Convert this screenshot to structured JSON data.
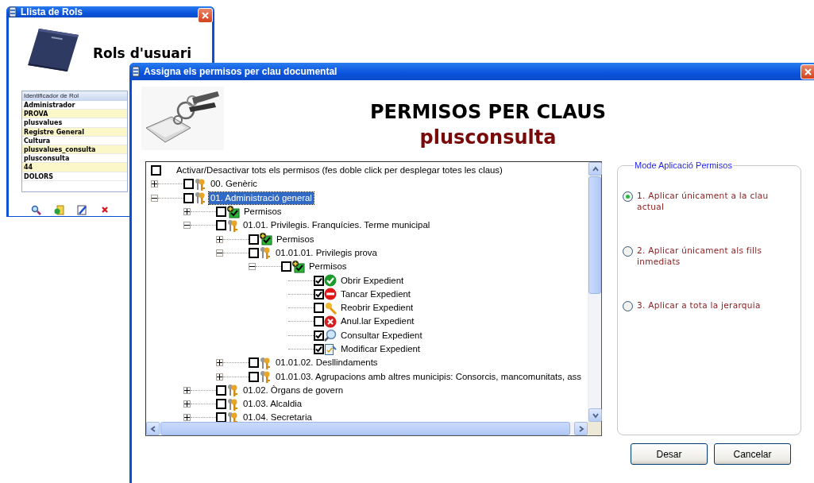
{
  "roles_window": {
    "title": "Llista de Rols",
    "heading": "Rols d'usuari",
    "table": {
      "columns": [
        "Identificador de Rol"
      ],
      "rows": [
        "Administrador",
        "PROVA",
        "plusvalues",
        "Registre General",
        "Cultura",
        "plusvalues_consulta",
        "plusconsulta",
        "44",
        "DOLORS"
      ]
    },
    "tools": [
      {
        "kind": "search"
      },
      {
        "kind": "add"
      },
      {
        "kind": "edit"
      },
      {
        "kind": "delete"
      }
    ]
  },
  "permissions_window": {
    "title": "Assigna els permisos per clau documental",
    "heading": "PERMISOS PER CLAUS",
    "role": "plusconsulta",
    "tree": {
      "toggle_all": {
        "label": "Activar/Desactivar tots els permisos (fes doble click per desplegar totes les claus)",
        "checked": false
      },
      "items": [
        {
          "label": "00. Genèric",
          "kind": "key",
          "checked": false,
          "expanded": false,
          "selected": false
        },
        {
          "label": "01. Administració general",
          "kind": "key",
          "checked": false,
          "expanded": true,
          "selected": true,
          "children": [
            {
              "label": "Permisos",
              "kind": "permissions",
              "checked": false,
              "expanded": false,
              "selected": false
            },
            {
              "label": "01.01. Privilegis. Franquícies. Terme municipal",
              "kind": "key",
              "checked": false,
              "expanded": true,
              "selected": false,
              "children": [
                {
                  "label": "Permisos",
                  "kind": "permissions",
                  "checked": false,
                  "expanded": false,
                  "selected": false
                },
                {
                  "label": "01.01.01. Privilegis prova",
                  "kind": "key",
                  "checked": false,
                  "expanded": true,
                  "selected": false,
                  "children": [
                    {
                      "label": "Permisos",
                      "kind": "permissions",
                      "checked": false,
                      "expanded": true,
                      "selected": false,
                      "children": [
                        {
                          "label": "Obrir Expedient",
                          "kind": "open",
                          "checked": true,
                          "selected": false
                        },
                        {
                          "label": "Tancar Expedient",
                          "kind": "close",
                          "checked": true,
                          "selected": false
                        },
                        {
                          "label": "Reobrir Expedient",
                          "kind": "reopen",
                          "checked": false,
                          "selected": false
                        },
                        {
                          "label": "Anul.lar Expedient",
                          "kind": "cancel",
                          "checked": false,
                          "selected": false
                        },
                        {
                          "label": "Consultar Expedient",
                          "kind": "consult",
                          "checked": true,
                          "selected": false
                        },
                        {
                          "label": "Modificar Expedient",
                          "kind": "modify",
                          "checked": true,
                          "selected": false
                        }
                      ]
                    }
                  ]
                },
                {
                  "label": "01.01.02. Desllindaments",
                  "kind": "key",
                  "checked": false,
                  "expanded": false,
                  "selected": false
                },
                {
                  "label": "01.01.03. Agrupacions amb altres municipis: Consorcis, mancomunitats, ass",
                  "kind": "key",
                  "checked": false,
                  "expanded": false,
                  "selected": false
                }
              ]
            },
            {
              "label": "01.02. Òrgans de govern",
              "kind": "key",
              "checked": false,
              "expanded": false,
              "selected": false
            },
            {
              "label": "01.03. Alcaldia",
              "kind": "key",
              "checked": false,
              "expanded": false,
              "selected": false
            },
            {
              "label": "01.04. Secretaria",
              "kind": "key",
              "checked": false,
              "expanded": false,
              "selected": false
            }
          ]
        }
      ]
    },
    "mode": {
      "legend": "Mode Aplicació Permisos",
      "options": [
        {
          "label": "1. Aplicar únicament a la clau actual",
          "selected": true
        },
        {
          "label": "2. Aplicar únicament als fills inmediats",
          "selected": false
        },
        {
          "label": "3. Aplicar a tota la jerarquia",
          "selected": false
        }
      ]
    },
    "buttons": [
      "Desar",
      "Cancelar"
    ]
  }
}
